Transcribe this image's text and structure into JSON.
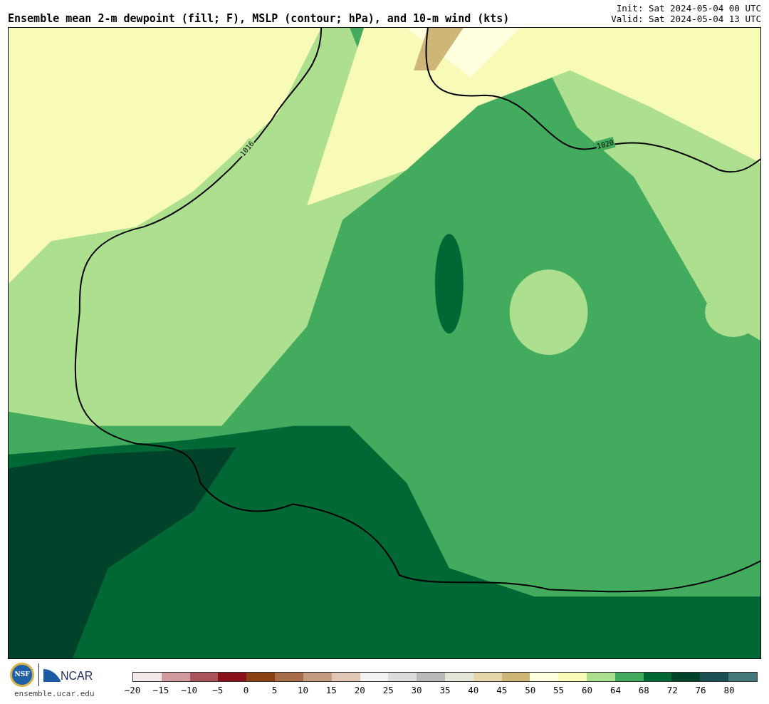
{
  "title": "Ensemble mean 2-m dewpoint (fill; F), MSLP (contour; hPa), and 10-m wind (kts)",
  "init": "Init: Sat 2024-05-04 00 UTC",
  "valid": "Valid: Sat 2024-05-04 13 UTC",
  "map": {
    "contour_labels": [
      "1016",
      "1020"
    ]
  },
  "logos": {
    "nsf": "NSF",
    "ncar": "NCAR"
  },
  "site": "ensemble.ucar.edu",
  "colorbar": {
    "bins": [
      {
        "color": "#f3e9e9"
      },
      {
        "color": "#d09a9f"
      },
      {
        "color": "#ab535a"
      },
      {
        "color": "#88111c"
      },
      {
        "color": "#8a4010"
      },
      {
        "color": "#a76d4b"
      },
      {
        "color": "#c49c80"
      },
      {
        "color": "#e0c6b4"
      },
      {
        "color": "#f3f3f3"
      },
      {
        "color": "#dcdcdc"
      },
      {
        "color": "#b9b9b9"
      },
      {
        "color": "#e3e6d6"
      },
      {
        "color": "#e6d6ac"
      },
      {
        "color": "#cdb677"
      },
      {
        "color": "#ffffe0"
      },
      {
        "color": "#f8fbb8"
      },
      {
        "color": "#acdf8e"
      },
      {
        "color": "#42ab5d"
      },
      {
        "color": "#006834"
      },
      {
        "color": "#00422a"
      },
      {
        "color": "#1a4f53"
      },
      {
        "color": "#44787a"
      }
    ],
    "ticks": [
      "−20",
      "−15",
      "−10",
      "−5",
      "0",
      "5",
      "10",
      "15",
      "20",
      "25",
      "30",
      "35",
      "40",
      "45",
      "50",
      "55",
      "60",
      "64",
      "68",
      "72",
      "76",
      "80"
    ]
  }
}
